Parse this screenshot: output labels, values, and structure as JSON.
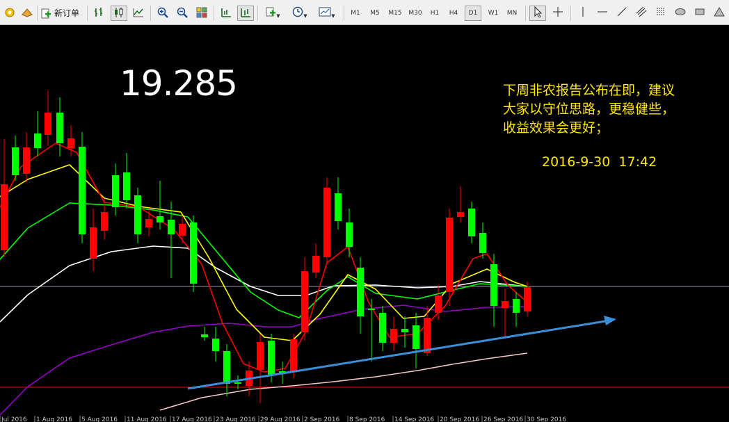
{
  "toolbar": {
    "new_order_label": "新订单",
    "timeframes": [
      "M1",
      "M5",
      "M15",
      "M30",
      "H1",
      "H4",
      "D1",
      "W1",
      "MN"
    ],
    "active_timeframe": "D1"
  },
  "chart": {
    "price_label": "19.285",
    "note_lines": [
      "下周非农报告公布在即，建议",
      "大家以守位思路，更稳健些，",
      "收益效果会更好；"
    ],
    "datetime": "2016-9-30  17:42",
    "x_axis_labels": [
      "Jul 2016",
      "1 Aug 2016",
      "5 Aug 2016",
      "11 Aug 2016",
      "17 Aug 2016",
      "23 Aug 2016",
      "29 Aug 2016",
      "2 Sep 2016",
      "8 Sep 2016",
      "14 Sep 2016",
      "20 Sep 2016",
      "26 Sep 2016",
      "30 Sep 2016"
    ],
    "colors": {
      "bull": "#00ff00",
      "bear": "#ff0000",
      "ma5": "#ff0000",
      "ma10": "#ffff00",
      "ma20": "#00ff00",
      "ma30": "#ffffff",
      "ma60": "#9900cc",
      "ma120": "#f5c6c6",
      "trendline": "#3a8fd9",
      "hline_current": "#9a9ab0",
      "hline_red": "#ff0000"
    }
  }
}
